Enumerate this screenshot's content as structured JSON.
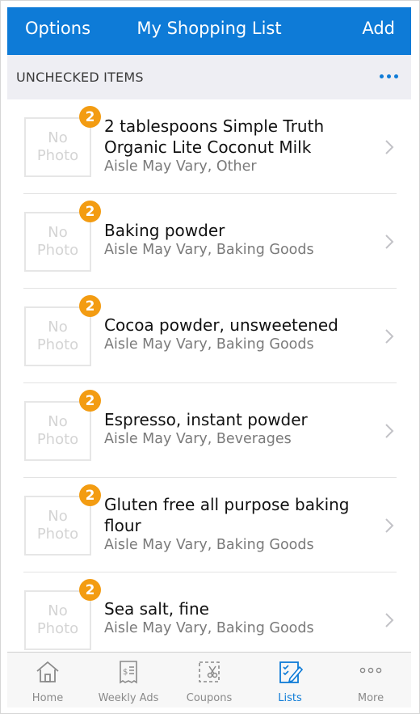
{
  "header": {
    "left_button": "Options",
    "title": "My Shopping List",
    "right_button": "Add"
  },
  "section": {
    "title": "UNCHECKED ITEMS",
    "more_icon": "ellipsis-icon"
  },
  "placeholder": {
    "line1": "No",
    "line2": "Photo"
  },
  "items": [
    {
      "name": "2 tablespoons Simple Truth Organic Lite Coconut Milk",
      "name_lines": [
        "2 tablespoons Simple Truth",
        "Organic Lite Coconut Milk"
      ],
      "detail": "Aisle May Vary, Other",
      "badge": "2"
    },
    {
      "name": "Baking powder",
      "name_lines": [
        "Baking powder"
      ],
      "detail": "Aisle May Vary, Baking Goods",
      "badge": "2"
    },
    {
      "name": "Cocoa powder, unsweetened",
      "name_lines": [
        "Cocoa powder, unsweetened"
      ],
      "detail": "Aisle May Vary, Baking Goods",
      "badge": "2"
    },
    {
      "name": "Espresso, instant powder",
      "name_lines": [
        "Espresso, instant powder"
      ],
      "detail": "Aisle May Vary, Beverages",
      "badge": "2"
    },
    {
      "name": "Gluten free all purpose baking flour",
      "name_lines": [
        "Gluten free all purpose baking",
        "flour"
      ],
      "detail": "Aisle May Vary, Baking Goods",
      "badge": "2"
    },
    {
      "name": "Sea salt, fine",
      "name_lines": [
        "Sea salt, fine"
      ],
      "detail": "Aisle May Vary, Baking Goods",
      "badge": "2"
    }
  ],
  "tabs": [
    {
      "label": "Home",
      "icon": "home-icon",
      "active": false
    },
    {
      "label": "Weekly Ads",
      "icon": "weekly-ads-icon",
      "active": false
    },
    {
      "label": "Coupons",
      "icon": "coupon-scissors-icon",
      "active": false
    },
    {
      "label": "Lists",
      "icon": "checklist-icon",
      "active": true
    },
    {
      "label": "More",
      "icon": "more-dots-icon",
      "active": false
    }
  ],
  "colors": {
    "brand_blue": "#0e7bd7",
    "badge_orange": "#f39c12",
    "section_bg": "#eeeef3"
  }
}
